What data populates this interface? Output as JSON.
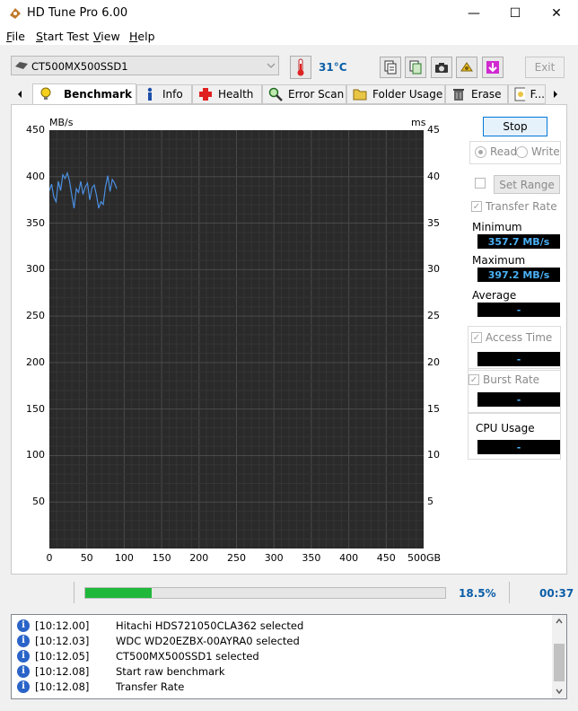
{
  "window": {
    "title": "HD Tune Pro 6.00",
    "minimize": "—",
    "maximize": "☐",
    "close": "✕"
  },
  "menu": [
    {
      "key": "F",
      "rest": "ile"
    },
    {
      "key": "S",
      "rest": "tart Test"
    },
    {
      "key": "V",
      "rest": "iew"
    },
    {
      "key": "H",
      "rest": "elp"
    }
  ],
  "toolbar": {
    "drive": "CT500MX500SSD1",
    "temperature": "31°C",
    "exit_label": "Exit"
  },
  "tabs": [
    {
      "label": "Benchmark",
      "icon": "lightbulb-icon"
    },
    {
      "label": "Info",
      "icon": "info-icon"
    },
    {
      "label": "Health",
      "icon": "health-cross-icon"
    },
    {
      "label": "Error Scan",
      "icon": "magnifier-icon"
    },
    {
      "label": "Folder Usage",
      "icon": "folder-icon"
    },
    {
      "label": "Erase",
      "icon": "trash-icon"
    },
    {
      "label": "F...",
      "icon": "file-icon"
    }
  ],
  "chart_data": {
    "type": "line",
    "ylabel_left": "MB/s",
    "ylabel_right": "ms",
    "y_left_ticks": [
      "450",
      "400",
      "350",
      "300",
      "250",
      "200",
      "150",
      "100",
      "50"
    ],
    "y_right_ticks": [
      "45",
      "40",
      "35",
      "30",
      "25",
      "20",
      "15",
      "10",
      "5"
    ],
    "x_ticks": [
      "0",
      "50",
      "100",
      "150",
      "200",
      "250",
      "300",
      "350",
      "400",
      "450",
      "500GB"
    ],
    "xlim": [
      0,
      500
    ],
    "ylim": [
      0,
      450
    ],
    "grid": true,
    "series": [
      {
        "color": "#4a90e2",
        "x": [
          0,
          3,
          6,
          9,
          12,
          15,
          18,
          21,
          24,
          27,
          30,
          33,
          36,
          39,
          42,
          45,
          48,
          51,
          54,
          57,
          60,
          63,
          66,
          69,
          72,
          75,
          78,
          81,
          84,
          87,
          90
        ],
        "y": [
          385,
          392,
          378,
          373,
          395,
          385,
          402,
          398,
          404,
          395,
          380,
          366,
          387,
          383,
          395,
          381,
          389,
          393,
          375,
          388,
          391,
          380,
          366,
          373,
          370,
          389,
          401,
          384,
          397,
          393,
          387
        ]
      }
    ]
  },
  "controls": {
    "stop_label": "Stop",
    "read_label": "Read",
    "write_label": "Write",
    "set_range_label": "Set Range",
    "transfer_rate_label": "Transfer Rate",
    "minimum_label": "Minimum",
    "minimum_value": "357.7 MB/s",
    "maximum_label": "Maximum",
    "maximum_value": "397.2 MB/s",
    "average_label": "Average",
    "average_value": "-",
    "access_time_label": "Access Time",
    "access_time_value": "-",
    "burst_rate_label": "Burst Rate",
    "burst_rate_value": "-",
    "cpu_usage_label": "CPU Usage",
    "cpu_usage_value": "-"
  },
  "progress": {
    "percent_text": "18.5%",
    "fraction": 0.185,
    "time": "00:37"
  },
  "log": [
    {
      "time": "[10:12.00]",
      "message": "Hitachi HDS721050CLA362 selected"
    },
    {
      "time": "[10:12.03]",
      "message": "WDC WD20EZBX-00AYRA0 selected"
    },
    {
      "time": "[10:12.05]",
      "message": "CT500MX500SSD1 selected"
    },
    {
      "time": "[10:12.08]",
      "message": "Start raw benchmark"
    },
    {
      "time": "[10:12.08]",
      "message": "Transfer Rate"
    }
  ],
  "colors": {
    "accent": "#0b5ea8",
    "value_text": "#4ab0f5",
    "progress": "#1fb83b"
  }
}
